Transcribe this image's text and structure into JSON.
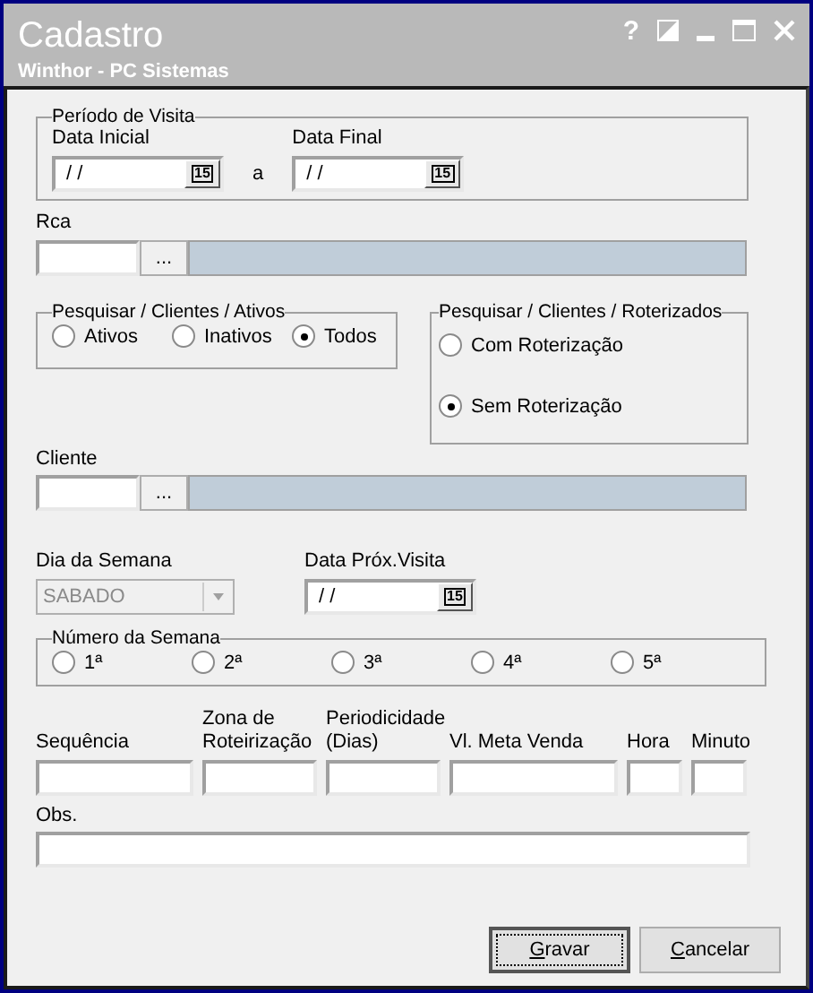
{
  "window": {
    "title": "Cadastro",
    "subtitle": "Winthor - PC Sistemas",
    "help_label": "?"
  },
  "periodo": {
    "legend": "Período de Visita",
    "separator": "a",
    "fields": [
      {
        "label": "Data Inicial",
        "value": "/ /",
        "calendar_label": "15"
      },
      {
        "label": "Data Final",
        "value": "/ /",
        "calendar_label": "15"
      }
    ]
  },
  "rca": {
    "label": "Rca",
    "browse_label": "..."
  },
  "ativos": {
    "legend": "Pesquisar / Clientes / Ativos",
    "options": [
      {
        "label": "Ativos",
        "selected": false
      },
      {
        "label": "Inativos",
        "selected": false
      },
      {
        "label": "Todos",
        "selected": true
      }
    ]
  },
  "roterizados": {
    "legend": "Pesquisar / Clientes / Roterizados",
    "options": [
      {
        "label": "Com Roterização",
        "selected": false
      },
      {
        "label": "Sem Roterização",
        "selected": true
      }
    ]
  },
  "cliente": {
    "label": "Cliente",
    "browse_label": "..."
  },
  "dia_semana": {
    "label": "Dia da Semana",
    "value": "SABADO",
    "disabled": true
  },
  "data_prox_visita": {
    "label": "Data Próx.Visita",
    "value": "/ /",
    "calendar_label": "15"
  },
  "numero_semana": {
    "legend": "Número da Semana",
    "options": [
      {
        "label": "1ª",
        "selected": false
      },
      {
        "label": "2ª",
        "selected": false
      },
      {
        "label": "3ª",
        "selected": false
      },
      {
        "label": "4ª",
        "selected": false
      },
      {
        "label": "5ª",
        "selected": false
      }
    ]
  },
  "fields": [
    {
      "label": "Sequência"
    },
    {
      "label": "Zona de Roteirização"
    },
    {
      "label": "Periodicidade (Dias)"
    },
    {
      "label": "Vl. Meta Venda"
    },
    {
      "label": "Hora"
    },
    {
      "label": "Minuto"
    }
  ],
  "obs": {
    "label": "Obs."
  },
  "buttons": [
    {
      "label": "Gravar",
      "default": true
    },
    {
      "label": "Cancelar",
      "default": false
    }
  ]
}
